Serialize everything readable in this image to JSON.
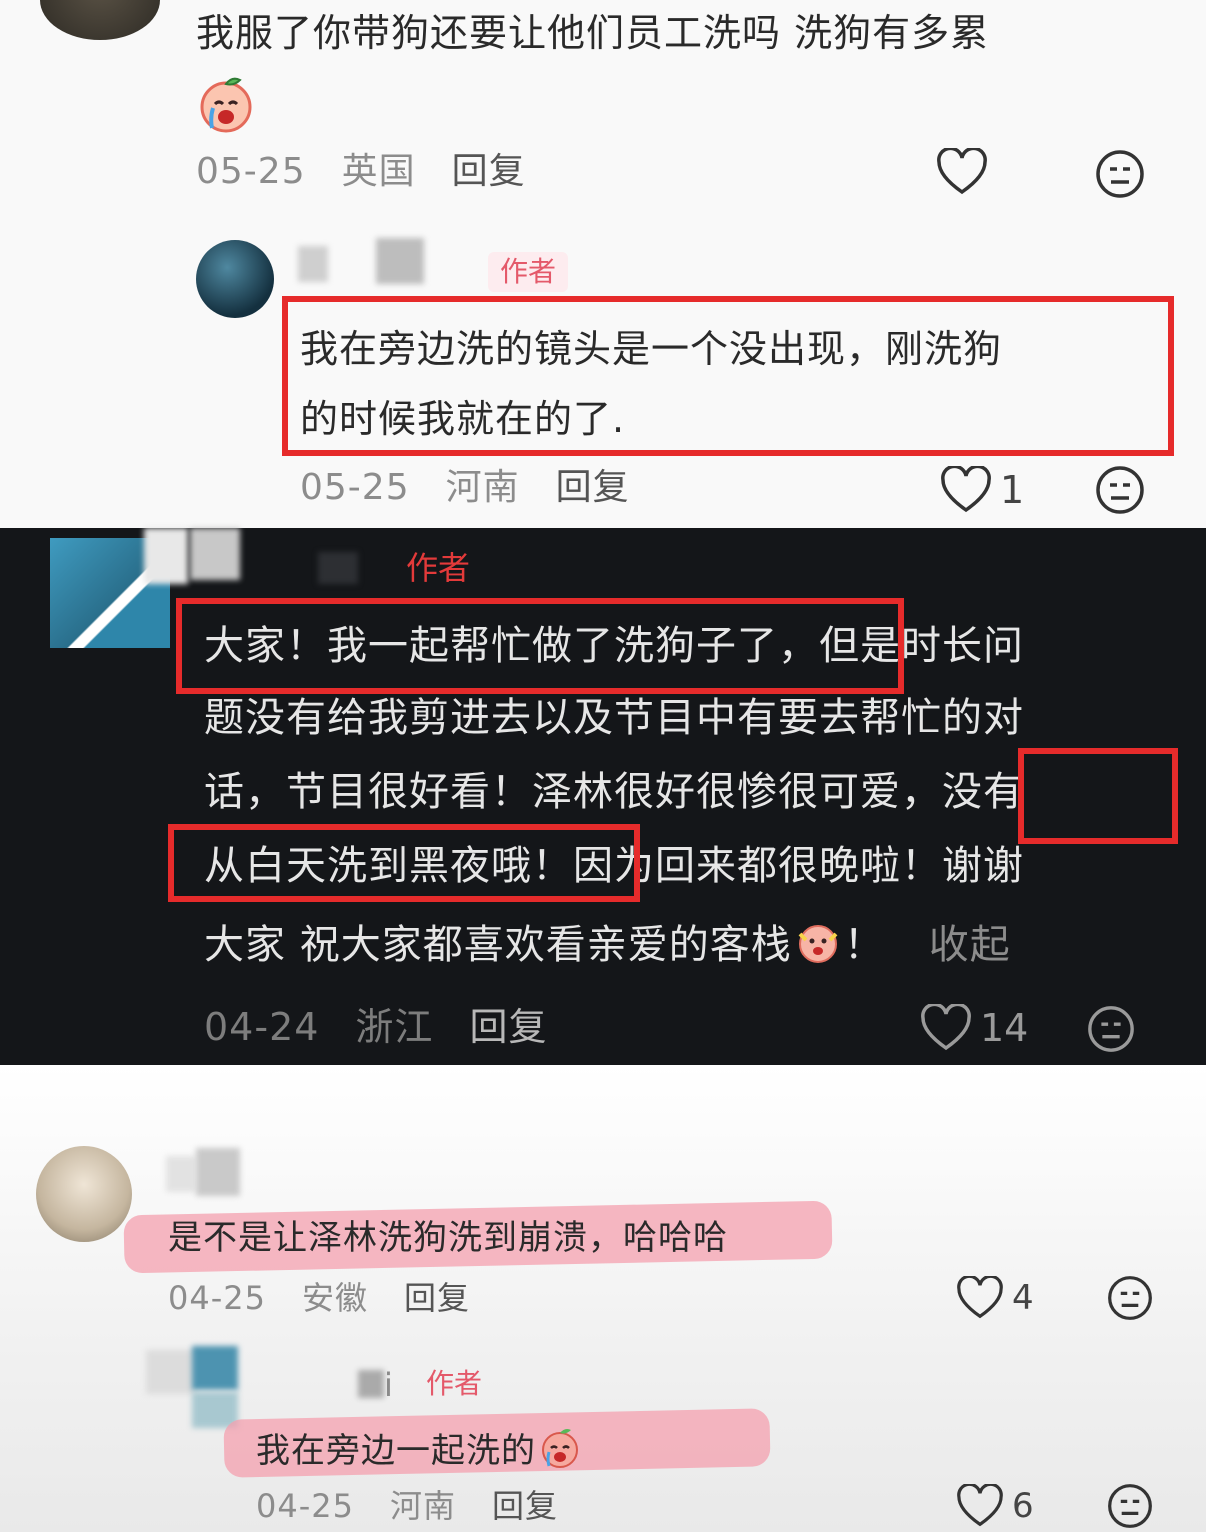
{
  "comments": [
    {
      "text_line1": "我服了你带狗还要让他们员工洗吗 洗狗有多累",
      "date": "05-25",
      "location": "英国",
      "reply_label": "回复",
      "likes": "",
      "emoji": "crying-peach-emoji"
    },
    {
      "author_tag": "作者",
      "text_line1": "我在旁边洗的镜头是一个没出现，刚洗狗",
      "text_line2": "的时候我就在的了.",
      "date": "05-25",
      "location": "河南",
      "reply_label": "回复",
      "likes": "1"
    },
    {
      "author_tag": "作者",
      "lines": [
        "大家！我一起帮忙做了洗狗子了，但是时长问",
        "题没有给我剪进去以及节目中有要去帮忙的对",
        "话，节目很好看！泽林很好很惨很可爱，没有",
        "从白天洗到黑夜哦！因为回来都很晚啦！谢谢"
      ],
      "line5_text": "大家 祝大家都喜欢看亲爱的客栈",
      "line5_suffix": "！",
      "collapse_label": "收起",
      "date": "04-24",
      "location": "浙江",
      "reply_label": "回复",
      "likes": "14"
    },
    {
      "text_line1": "是不是让泽林洗狗洗到崩溃，哈哈哈",
      "date": "04-25",
      "location": "安徽",
      "reply_label": "回复",
      "likes": "4"
    },
    {
      "author_tag": "作者",
      "username_fragment": "i",
      "text_line1": "我在旁边一起洗的",
      "date": "04-25",
      "location": "河南",
      "reply_label": "回复",
      "likes": "6"
    }
  ],
  "colors": {
    "annotation_red": "#e62b2b",
    "highlight_pink": "#f4a0af",
    "dark_bg": "#141619",
    "author_tag": "#e4596a"
  }
}
